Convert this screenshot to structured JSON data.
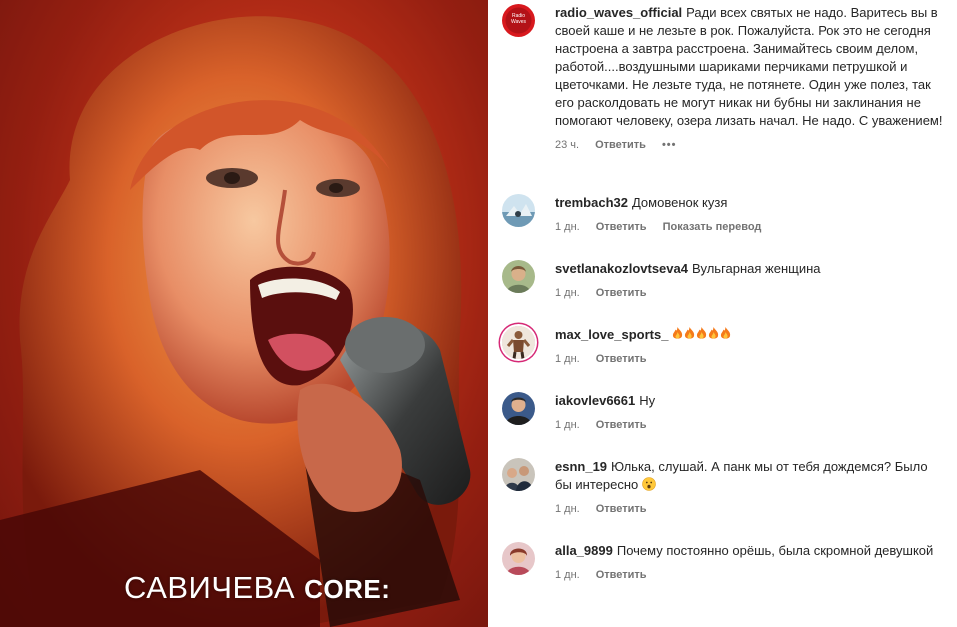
{
  "media": {
    "caption_main": "САВИЧЕВА",
    "caption_suffix": "CORE:"
  },
  "comments": [
    {
      "username": "radio_waves_official",
      "avatar": "radio-waves-logo",
      "text": "Ради всех святых не надо. Варитесь вы в своей каше и не лезьте в рок. Пожалуйста. Рок это не сегодня настроена а завтра расстроена. Занимайтесь своим делом, работой....воздушными шариками перчиками петрушкой и цветочками. Не лезьте туда, не потянете. Один уже полез, так его расколдовать не могут никак ни бубны ни заклинания не помогают человеку, озера лизать начал. Не надо. С уважением!",
      "time": "23 ч.",
      "reply": "Ответить",
      "more": "•••"
    },
    {
      "username": "trembach32",
      "avatar": "landscape-avatar",
      "text": "Домовенок кузя",
      "time": "1 дн.",
      "reply": "Ответить",
      "translate": "Показать перевод"
    },
    {
      "username": "svetlanakozlovtseva4",
      "avatar": "portrait-avatar",
      "text": "Вульгарная женщина",
      "time": "1 дн.",
      "reply": "Ответить"
    },
    {
      "username": "max_love_sports_",
      "avatar": "athlete-avatar",
      "text": "",
      "emoji": "fire-emoji x5",
      "time": "1 дн.",
      "reply": "Ответить"
    },
    {
      "username": "iakovlev6661",
      "avatar": "man-avatar",
      "text": "Ну",
      "time": "1 дн.",
      "reply": "Ответить"
    },
    {
      "username": "esnn_19",
      "avatar": "group-avatar",
      "text": "Юлька, слушай. А панк мы от тебя дождемся? Было бы интересно",
      "emoji": "surprised-face-emoji",
      "time": "1 дн.",
      "reply": "Ответить"
    },
    {
      "username": "alla_9899",
      "avatar": "woman-avatar",
      "text": "Почему постоянно орёшь, была скромной девушкой",
      "time": "1 дн.",
      "reply": "Ответить"
    }
  ]
}
